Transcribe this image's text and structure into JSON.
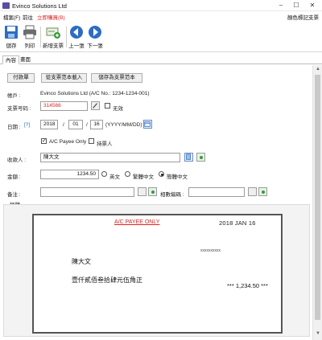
{
  "window": {
    "title": "Evinco Solutions Ltd"
  },
  "menu": {
    "items": [
      "檔案(F)",
      "前往"
    ],
    "special": "立即購買(B)",
    "right_label": "顏色標記支票"
  },
  "toolbar": {
    "save": "儲存",
    "print": "列印",
    "new_cheque": "新增支票",
    "prev": "上一張",
    "next": "下一張"
  },
  "tabs": [
    "內容",
    "畫面"
  ],
  "actions": {
    "pay_slip": "付款單",
    "load_template": "從支票范本載入",
    "save_template": "儲存為支票范本"
  },
  "form": {
    "account_label": "帳戶 :",
    "account_value": "Evinco Solutions Ltd (A/C No.: 1234-1234-001)",
    "cheque_no_label": "支票号码 :",
    "cheque_no": "314566",
    "void_label": "无效",
    "date_label": "日期 :",
    "date_help": "[?]",
    "year": "2018",
    "month": "01",
    "day": "16",
    "date_sep": "/",
    "date_format": "(YYYY/MM/DD)",
    "payee_only_label": "A/C Payee Only",
    "bearer_label": "持票人",
    "payee_label": "收款人 :",
    "payee": "陳大文",
    "amount_label": "金額 :",
    "amount": "1234.50",
    "lang_english": "英文",
    "lang_trad": "繁體中文",
    "lang_simp": "簡體中文",
    "remark_label": "备注 :",
    "category_label": "相數編碼 :",
    "preview_label": "預覽"
  },
  "cheque_preview": {
    "payee_only": "A/C PAYEE ONLY",
    "date": "2018 JAN 16",
    "xline": "xxxxxxxxxx",
    "payee": "陳大文",
    "amount_words": "壹仟貳佰叁拾肆元伍角正",
    "amount_figures": "*** 1,234.50 ***"
  },
  "colors": {
    "accent_red": "#d22222",
    "toolbar_blue": "#2d6cc4"
  }
}
